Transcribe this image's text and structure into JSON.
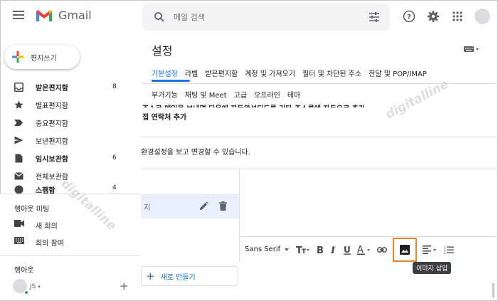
{
  "header": {
    "app_name": "Gmail",
    "search_placeholder": "메일 검색"
  },
  "compose": {
    "label": "편지쓰기"
  },
  "sidebar": {
    "items": [
      {
        "label": "받은편지함",
        "count": "8",
        "bold": true,
        "icon": "inbox-icon"
      },
      {
        "label": "별표편지함",
        "count": "",
        "bold": false,
        "icon": "star-icon"
      },
      {
        "label": "중요편지함",
        "count": "",
        "bold": false,
        "icon": "important-icon"
      },
      {
        "label": "보낸편지함",
        "count": "",
        "bold": false,
        "icon": "send-icon"
      },
      {
        "label": "임시보관함",
        "count": "6",
        "bold": true,
        "icon": "draft-icon"
      },
      {
        "label": "전체보관함",
        "count": "",
        "bold": false,
        "icon": "all-mail-icon"
      },
      {
        "label": "스팸함",
        "count": "4",
        "bold": false,
        "icon": "spam-icon"
      }
    ]
  },
  "meet": {
    "title": "행아웃 미팅",
    "items": [
      {
        "label": "새 회의",
        "icon": "video-camera-icon"
      },
      {
        "label": "회의 참여",
        "icon": "keyboard-icon"
      }
    ]
  },
  "hangouts": {
    "title": "행아웃",
    "user": "JS"
  },
  "settings": {
    "title": "설정",
    "tabs_row1": [
      "기본설정",
      "라벨",
      "받은편지함",
      "계정 및 가져오기",
      "필터 및 차단된 주소",
      "전달 및 POP/IMAP"
    ],
    "tabs_row2": [
      "부가기능",
      "채팅 및 Meet",
      "고급",
      "오프라인",
      "테마"
    ],
    "cut_text": "주소로 메일을 보내면 다음에 자동완성되도록 기타 주소록에 자동으로 추가",
    "contact_text": "접 연락처 추가",
    "info_text": "환경설정을 보고 변경할 수 있습니다.",
    "signature_name": "지",
    "new_button": "새로 만들기"
  },
  "toolbar": {
    "font": "Sans Serif",
    "tooltip": "이미지 삽입"
  },
  "colors": {
    "accent": "#1a73e8",
    "highlight": "#e8822d",
    "selected_row": "#e8f0fe"
  },
  "watermark": "digitalline"
}
